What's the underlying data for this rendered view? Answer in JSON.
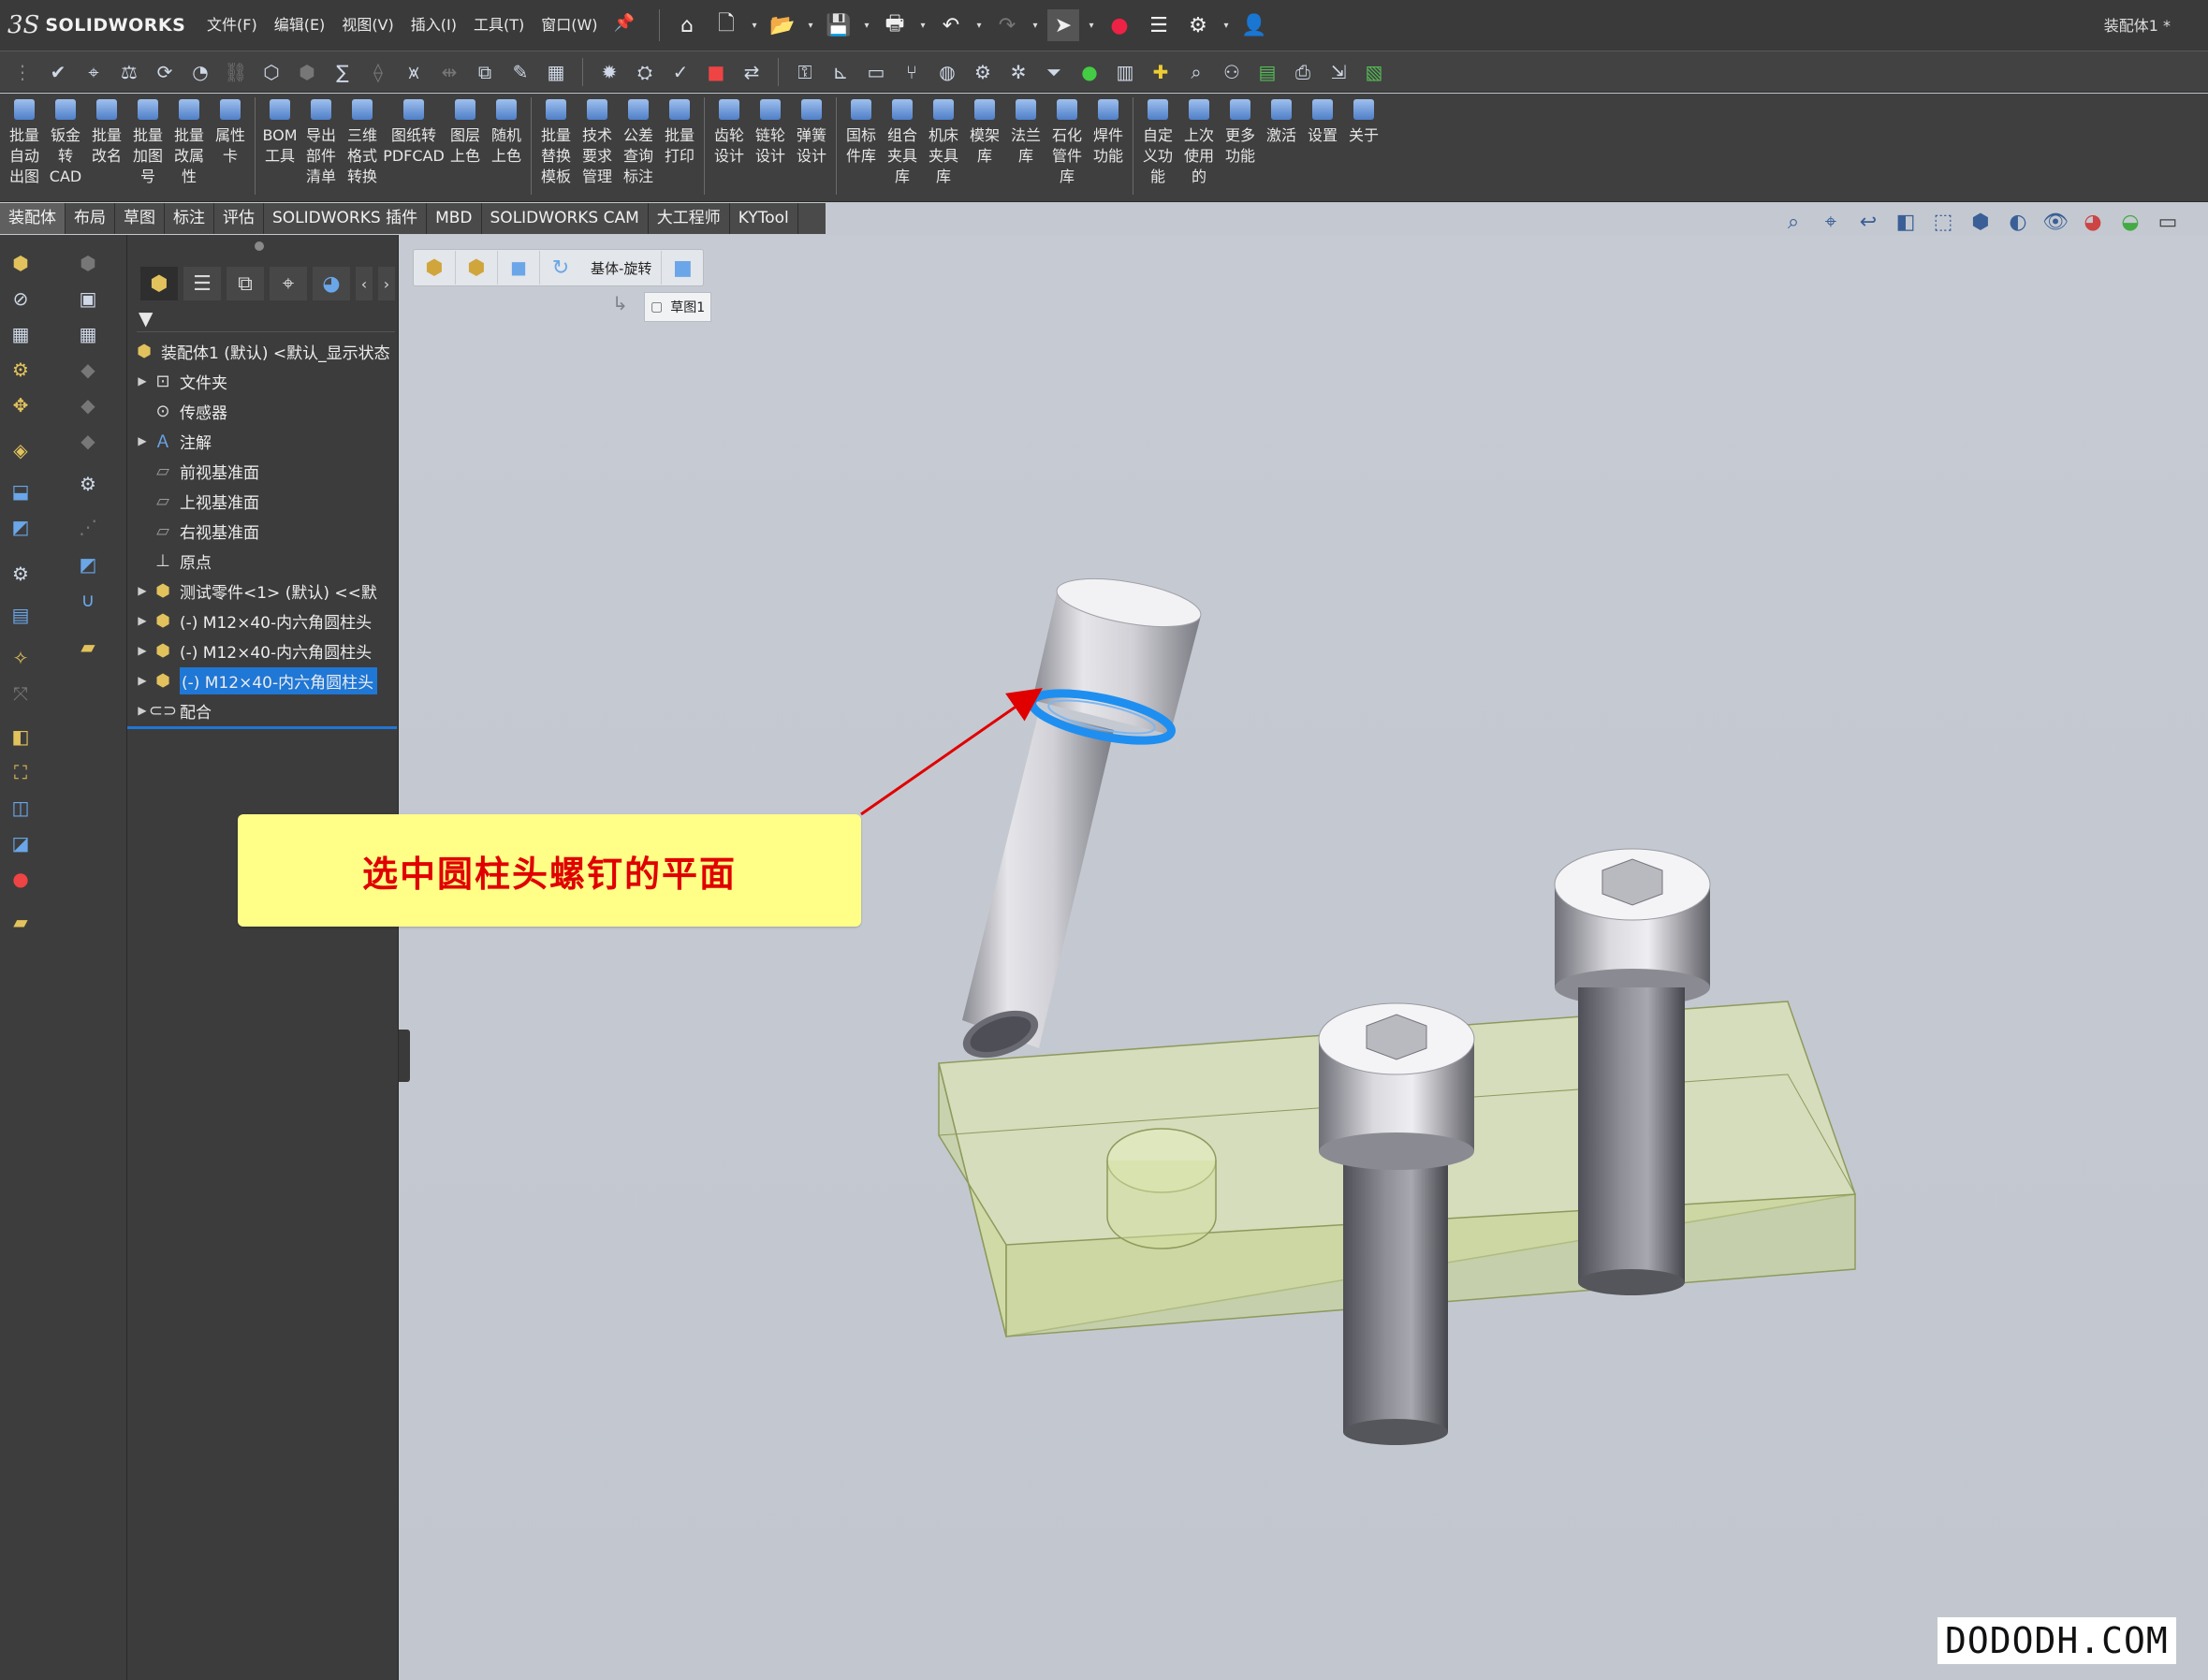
{
  "app": {
    "brand": "SOLIDWORKS",
    "document_title": "装配体1 *"
  },
  "menu": [
    "文件(F)",
    "编辑(E)",
    "视图(V)",
    "插入(I)",
    "工具(T)",
    "窗口(W)"
  ],
  "ribbon": [
    "批量\n自动\n出图",
    "钣金\n转\nCAD",
    "批量\n改名",
    "批量\n加图\n号",
    "批量\n改属\n性",
    "属性\n卡",
    "BOM\n工具",
    "导出\n部件\n清单",
    "三维\n格式\n转换",
    "图纸转\nPDFCAD",
    "图层\n上色",
    "随机\n上色",
    "批量\n替换\n模板",
    "技术\n要求\n管理",
    "公差\n查询\n标注",
    "批量\n打印",
    "齿轮\n设计",
    "链轮\n设计",
    "弹簧\n设计",
    "国标\n件库",
    "组合\n夹具\n库",
    "机床\n夹具\n库",
    "模架\n库",
    "法兰\n库",
    "石化\n管件\n库",
    "焊件\n功能",
    "自定\n义功\n能",
    "上次\n使用\n的",
    "更多\n功能",
    "激活",
    "设置",
    "关于"
  ],
  "tabs": [
    "装配体",
    "布局",
    "草图",
    "标注",
    "评估",
    "SOLIDWORKS 插件",
    "MBD",
    "SOLIDWORKS CAM",
    "大工程师",
    "KYTool"
  ],
  "active_tab": "装配体",
  "tree": {
    "root": "装配体1 (默认) <默认_显示状态",
    "items": [
      {
        "label": "文件夹",
        "expandable": true,
        "icon": "folder-icon"
      },
      {
        "label": "传感器",
        "expandable": false,
        "icon": "sensor-icon"
      },
      {
        "label": "注解",
        "expandable": true,
        "icon": "annotation-icon"
      },
      {
        "label": "前视基准面",
        "expandable": false,
        "icon": "plane-icon"
      },
      {
        "label": "上视基准面",
        "expandable": false,
        "icon": "plane-icon"
      },
      {
        "label": "右视基准面",
        "expandable": false,
        "icon": "plane-icon"
      },
      {
        "label": "原点",
        "expandable": false,
        "icon": "origin-icon"
      },
      {
        "label": "测试零件<1> (默认) <<默",
        "expandable": true,
        "icon": "part-icon"
      },
      {
        "label": "(-) M12×40-内六角圆柱头",
        "expandable": true,
        "icon": "part-icon"
      },
      {
        "label": "(-) M12×40-内六角圆柱头",
        "expandable": true,
        "icon": "part-icon"
      },
      {
        "label": "(-) M12×40-内六角圆柱头",
        "expandable": true,
        "icon": "part-icon",
        "selected": true
      },
      {
        "label": "配合",
        "expandable": true,
        "icon": "mates-icon"
      }
    ]
  },
  "breadcrumb": {
    "feature": "基体-旋转",
    "sketch": "草图1"
  },
  "annotation": {
    "text": "选中圆柱头螺钉的平面",
    "text_color": "#e00000",
    "fill": "#ffff88",
    "arrow_color": "#e00000"
  },
  "selection_color": "#1e8ff0",
  "watermark": "DODODH.COM"
}
